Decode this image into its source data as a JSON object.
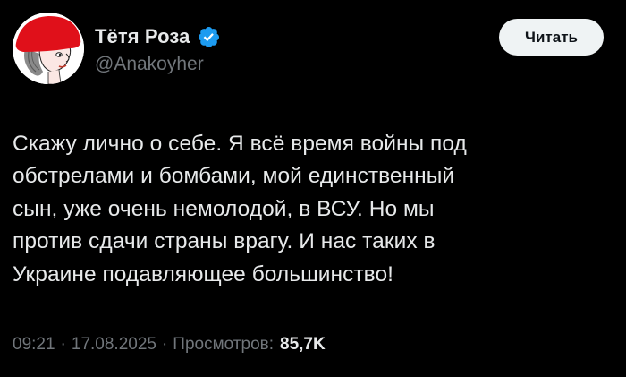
{
  "author": {
    "display_name": "Тётя Роза",
    "handle": "@Anakoyher",
    "verified": true,
    "avatar_icon": "avatar-woman-red-hat-icon",
    "verified_icon": "verified-badge-icon"
  },
  "follow_button": {
    "label": "Читать"
  },
  "tweet": {
    "text": "Скажу лично о себе. Я всё время войны под\nобстрелами и бомбами, мой единственный\nсын, уже очень немолодой, в ВСУ. Но мы\nпротив сдачи страны врагу. И нас таких в\nУкраине подавляющее большинство!"
  },
  "meta": {
    "time": "09:21",
    "separator": "·",
    "date": "17.08.2025",
    "views_label": "Просмотров:",
    "views_count": "85,7K"
  },
  "colors": {
    "background": "#000000",
    "text_primary": "#e7e9ea",
    "text_secondary": "#71767b",
    "verified_blue": "#1d9bf0",
    "button_bg": "#eff3f4",
    "button_text": "#0f1419",
    "avatar_hat": "#e0101a"
  }
}
